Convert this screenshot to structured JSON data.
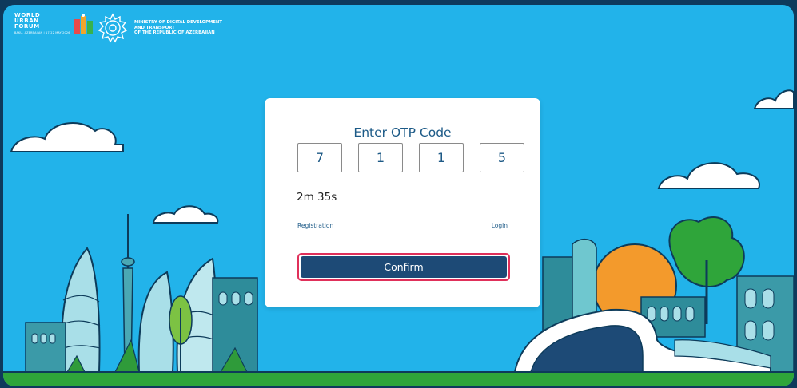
{
  "header": {
    "wuf_lines": [
      "WORLD",
      "URBAN",
      "FORUM"
    ],
    "wuf_caption": "BAKU, AZERBAIJAN | 17-22 MAY 2026",
    "ministry_lines": [
      "MINISTRY OF DIGITAL DEVELOPMENT",
      "AND TRANSPORT",
      "OF THE REPUBLIC OF AZERBAIJAN"
    ]
  },
  "otp": {
    "title": "Enter OTP Code",
    "digits": [
      "7",
      "1",
      "1",
      "5"
    ],
    "timer": "2m 35s",
    "registration_label": "Registration",
    "login_label": "Login",
    "confirm_label": "Confirm"
  },
  "colors": {
    "sky": "#22b3ea",
    "primary_button": "#1d4a76",
    "button_outline": "#e0305a",
    "title": "#1c5a87",
    "ground": "#2fa53a"
  }
}
